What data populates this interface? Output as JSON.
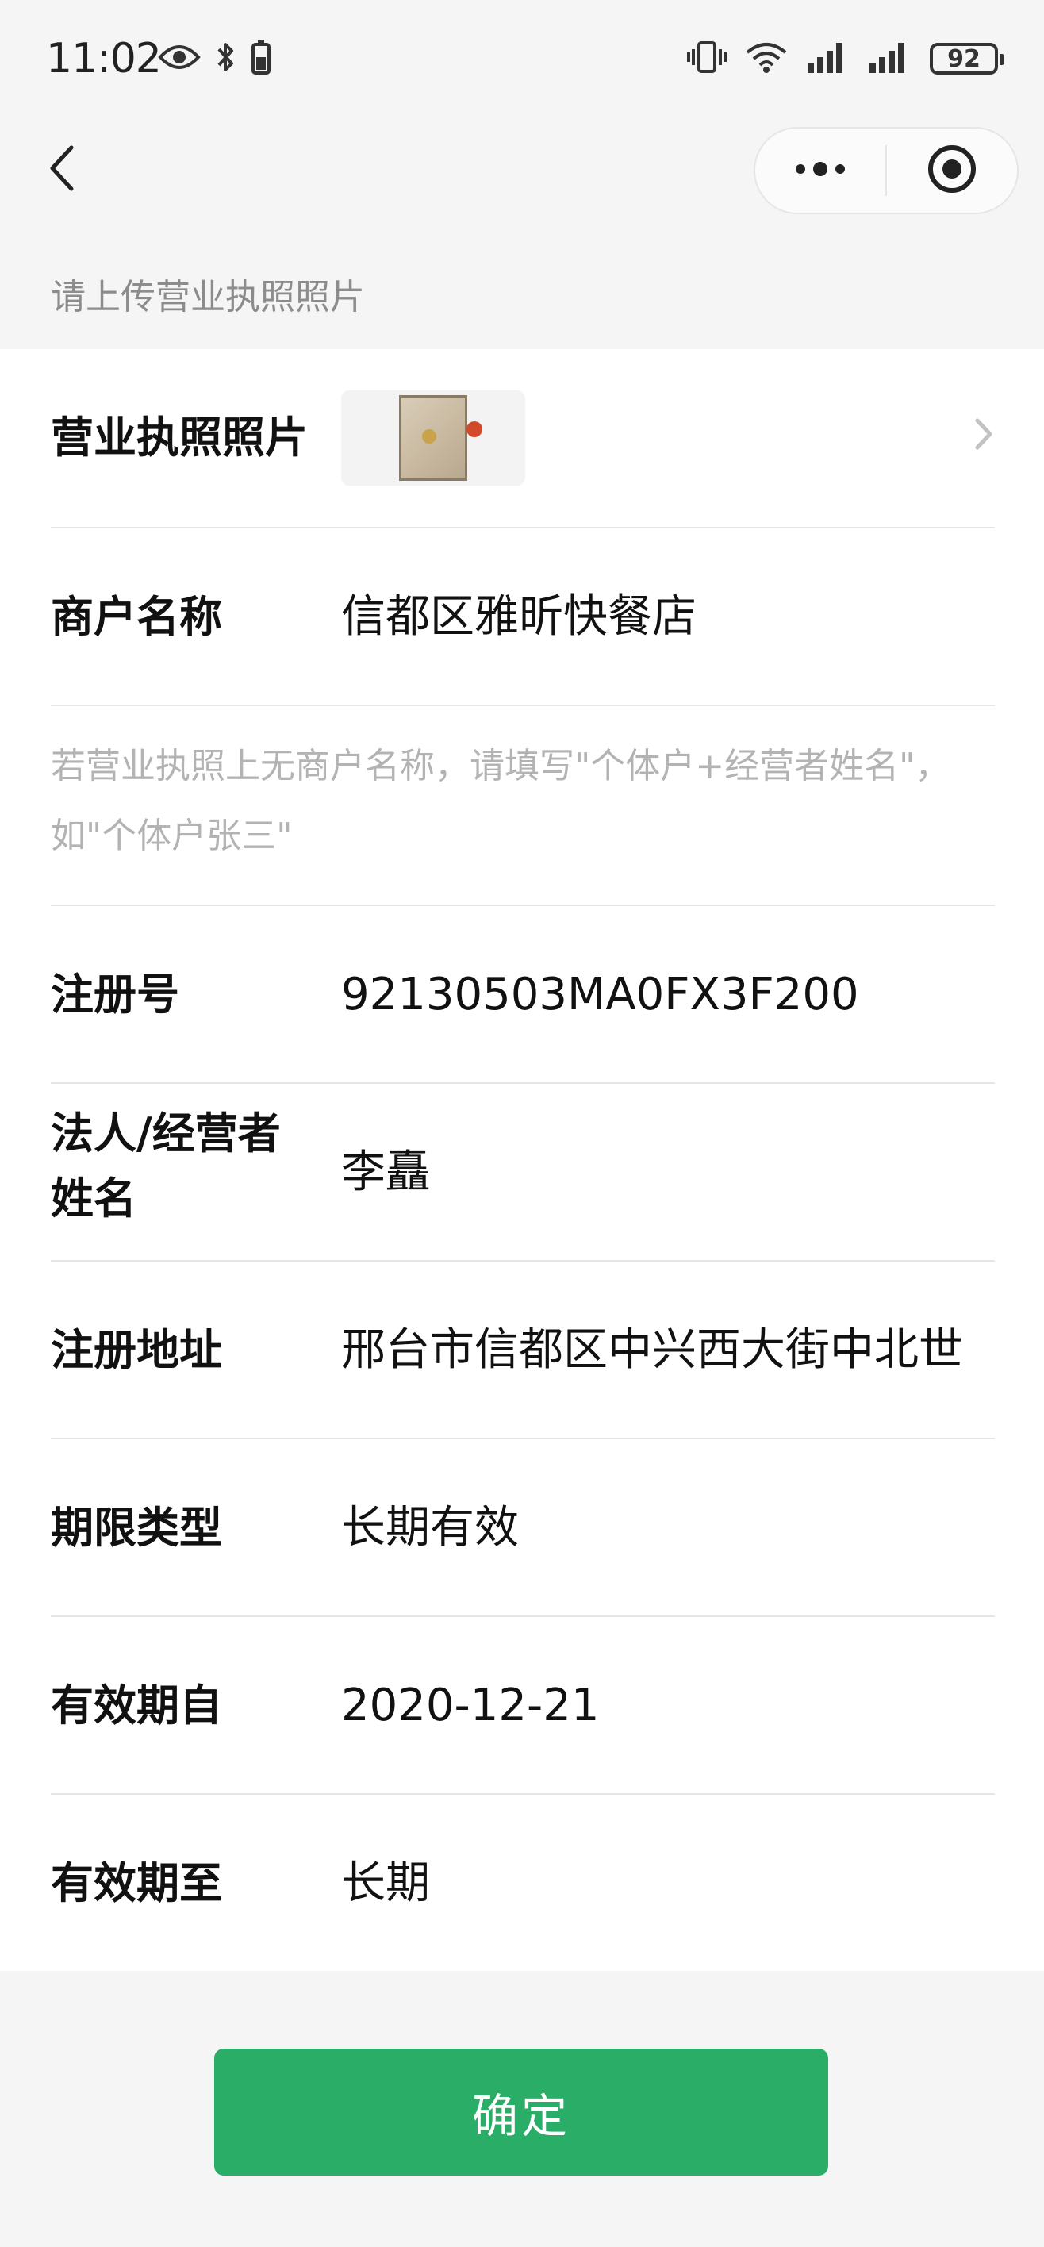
{
  "status_bar": {
    "time": "11:02",
    "battery": "92"
  },
  "nav": {
    "back_icon": "chevron-left-icon",
    "more_icon": "more-dots-icon",
    "close_icon": "record-target-icon"
  },
  "section_hint": "请上传营业执照照片",
  "form": {
    "license_photo": {
      "label": "营业执照照片"
    },
    "merchant_name": {
      "label": "商户名称",
      "value": "信都区雅昕快餐店"
    },
    "merchant_hint": {
      "line1": "若营业执照上无商户名称，请填写\"个体户+经营者姓名\"，",
      "line2": "如\"个体户张三\""
    },
    "registration_no": {
      "label": "注册号",
      "value": "92130503MA0FX3F200"
    },
    "legal_person": {
      "label_line1": "法人/经营者",
      "label_line2": "姓名",
      "value": "李矗"
    },
    "registered_address": {
      "label": "注册地址",
      "value": "邢台市信都区中兴西大街中北世"
    },
    "term_type": {
      "label": "期限类型",
      "value": "长期有效"
    },
    "valid_from": {
      "label": "有效期自",
      "value": "2020-12-21"
    },
    "valid_to": {
      "label": "有效期至",
      "value": "长期"
    }
  },
  "confirm_button": "确定",
  "colors": {
    "primary": "#2aae67",
    "background": "#f5f5f5",
    "hint": "#b3b3b3"
  }
}
